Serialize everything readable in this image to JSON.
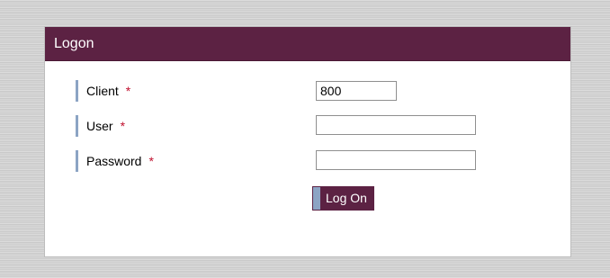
{
  "panel": {
    "title": "Logon"
  },
  "fields": {
    "client": {
      "label": "Client",
      "required_mark": "*",
      "value": "800"
    },
    "user": {
      "label": "User",
      "required_mark": "*",
      "value": ""
    },
    "password": {
      "label": "Password",
      "required_mark": "*",
      "value": ""
    }
  },
  "actions": {
    "logon_label": "Log On"
  },
  "colors": {
    "header_background": "#5c2243",
    "field_marker": "#8ca4c4",
    "required": "#c0102e",
    "page_background": "#d2d2d2"
  }
}
